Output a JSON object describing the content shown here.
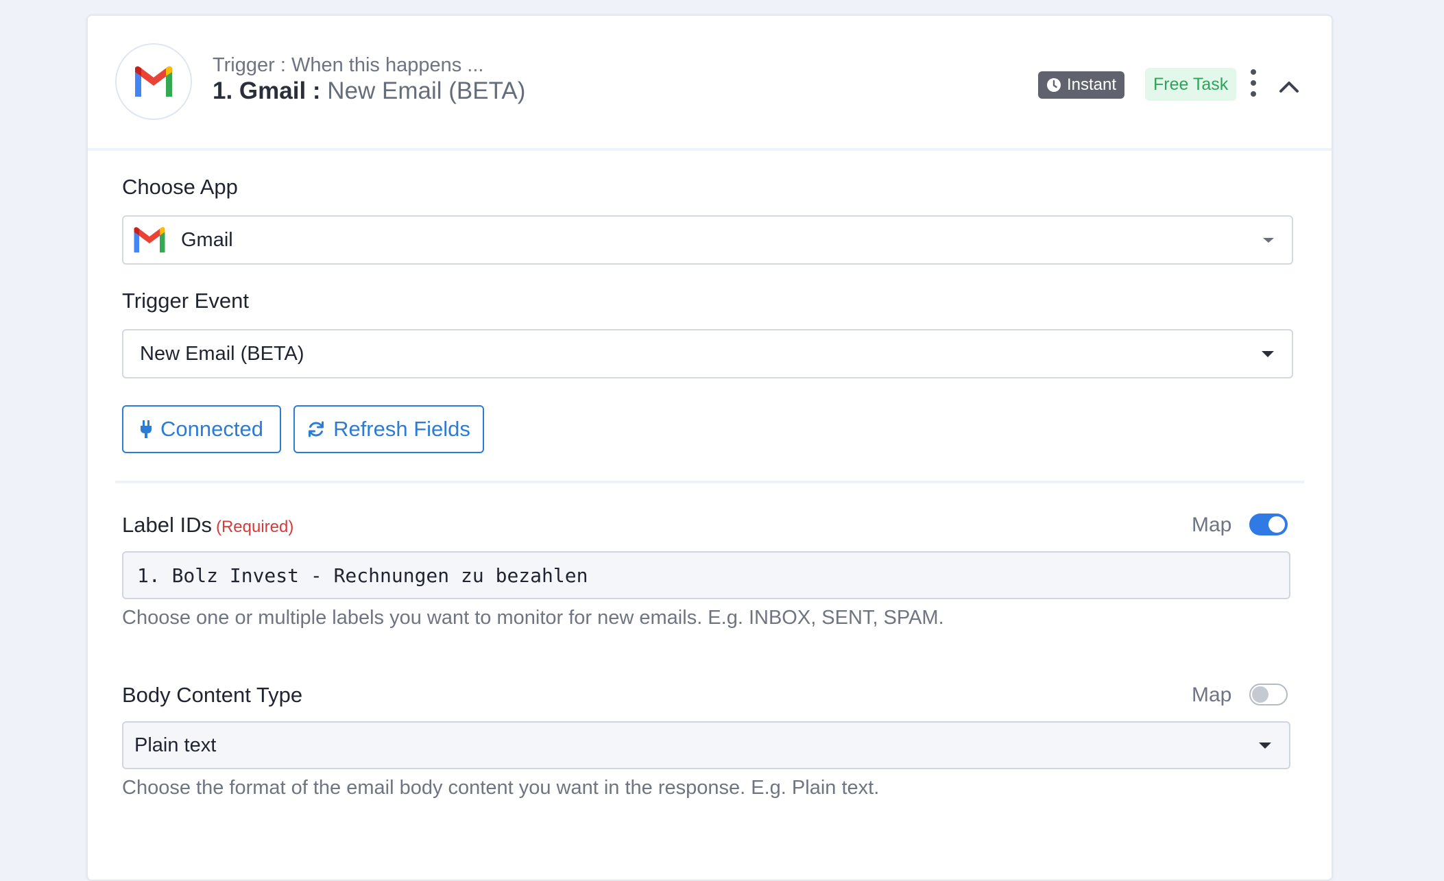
{
  "trigger": {
    "eyebrow": "Trigger : When this happens ...",
    "title_prefix": "1. Gmail :",
    "title_event": "New Email (BETA)",
    "badge_instant": "Instant",
    "badge_free": "Free Task"
  },
  "form": {
    "choose_app": {
      "label": "Choose App",
      "value": "Gmail",
      "icon": "gmail-logo-icon"
    },
    "trigger_event": {
      "label": "Trigger Event",
      "value": "New Email (BETA)"
    },
    "buttons": {
      "connected": "Connected",
      "refresh": "Refresh Fields"
    },
    "label_ids": {
      "label": "Label IDs",
      "required": "(Required)",
      "map_label": "Map",
      "map_on": true,
      "value": "1. Bolz Invest - Rechnungen zu bezahlen",
      "help": "Choose one or multiple labels you want to monitor for new emails. E.g. INBOX, SENT, SPAM."
    },
    "body_content_type": {
      "label": "Body Content Type",
      "map_label": "Map",
      "map_on": false,
      "value": "Plain text",
      "help": "Choose the format of the email body content you want in the response. E.g. Plain text."
    }
  },
  "colors": {
    "accent": "#2b7cd6",
    "toggle_on": "#2f7ae5",
    "required": "#d63b3b",
    "free_bg": "#e3f7ea",
    "free_text": "#2fa35a",
    "instant_bg": "#60636d"
  }
}
